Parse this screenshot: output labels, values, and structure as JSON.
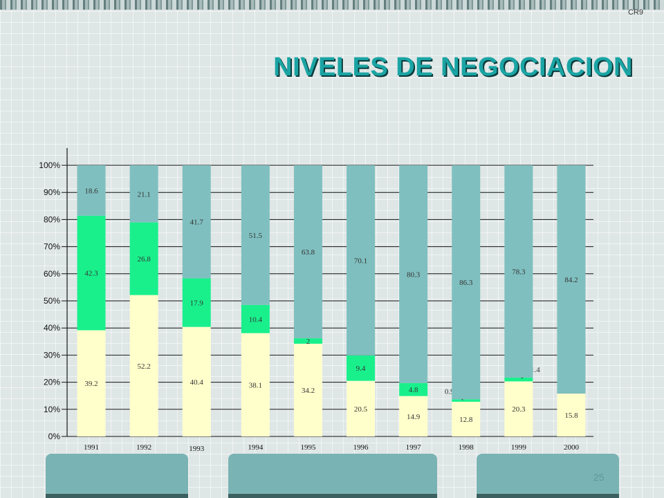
{
  "corner_tag": "CR9",
  "page_number": "25",
  "colors": {
    "series1": "#ffffcc",
    "series2": "#19f08c",
    "series3": "#80bfbf",
    "title": "#1ba4a4"
  },
  "chart_data": {
    "type": "bar",
    "stacked": true,
    "percent_stacked": true,
    "title": "NIVELES DE NEGOCIACION",
    "categories": [
      "1991",
      "1992",
      "1993",
      "1994",
      "1995",
      "1996",
      "1997",
      "1998",
      "1999",
      "2000"
    ],
    "series": [
      {
        "values": [
          39.2,
          52.2,
          40.4,
          38.1,
          34.2,
          20.5,
          14.9,
          12.8,
          20.3,
          15.8
        ]
      },
      {
        "values": [
          42.3,
          26.8,
          17.9,
          10.4,
          2,
          9.4,
          4.8,
          0.9,
          1.4,
          0
        ]
      },
      {
        "values": [
          18.6,
          21.1,
          41.7,
          51.5,
          63.8,
          70.1,
          80.3,
          86.3,
          78.3,
          84.2
        ]
      }
    ],
    "y_ticks": [
      "0%",
      "10%",
      "20%",
      "30%",
      "40%",
      "50%",
      "60%",
      "70%",
      "80%",
      "90%",
      "100%"
    ],
    "ylim": [
      0,
      100
    ],
    "grid": true,
    "legend": "none"
  }
}
